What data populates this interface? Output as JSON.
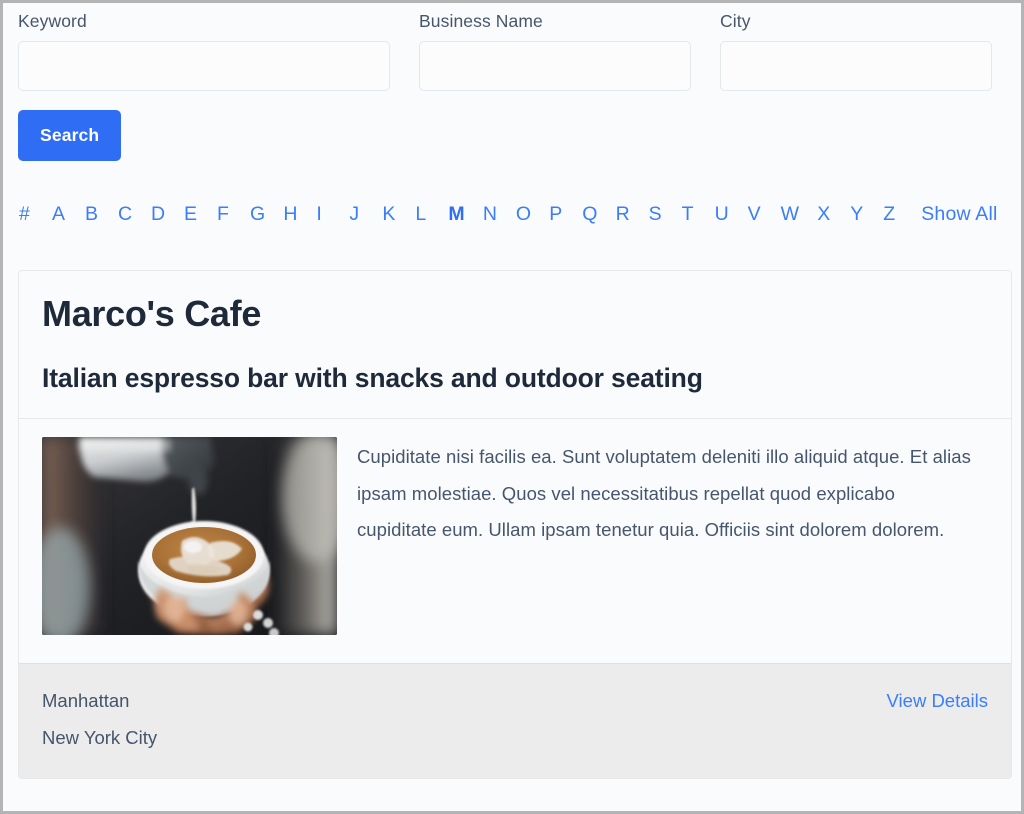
{
  "search": {
    "fields": [
      {
        "label": "Keyword",
        "value": "",
        "placeholder": ""
      },
      {
        "label": "Business Name",
        "value": "",
        "placeholder": ""
      },
      {
        "label": "City",
        "value": "",
        "placeholder": ""
      }
    ],
    "submit_label": "Search",
    "submit_color": "#2f6ef4"
  },
  "alpha_nav": {
    "letters": [
      "#",
      "A",
      "B",
      "C",
      "D",
      "E",
      "F",
      "G",
      "H",
      "I",
      "J",
      "K",
      "L",
      "M",
      "N",
      "O",
      "P",
      "Q",
      "R",
      "S",
      "T",
      "U",
      "V",
      "W",
      "X",
      "Y",
      "Z"
    ],
    "active_letter": "M",
    "show_all_label": "Show All",
    "link_color": "#3b7dfb"
  },
  "result": {
    "title": "Marco's Cafe",
    "subtitle": "Italian espresso bar with snacks and outdoor seating",
    "description": "Cupiditate nisi facilis ea. Sunt voluptatem deleniti illo aliquid atque. Et alias ipsam molestiae. Quos vel necessitatibus repellat quod explicabo cupiditate eum. Ullam ipsam tenetur quia. Officiis sint dolorem dolorem.",
    "image_alt": "barista pouring steamed milk into a latte cup",
    "neighborhood": "Manhattan",
    "city": "New York City",
    "details_link_label": "View Details"
  }
}
